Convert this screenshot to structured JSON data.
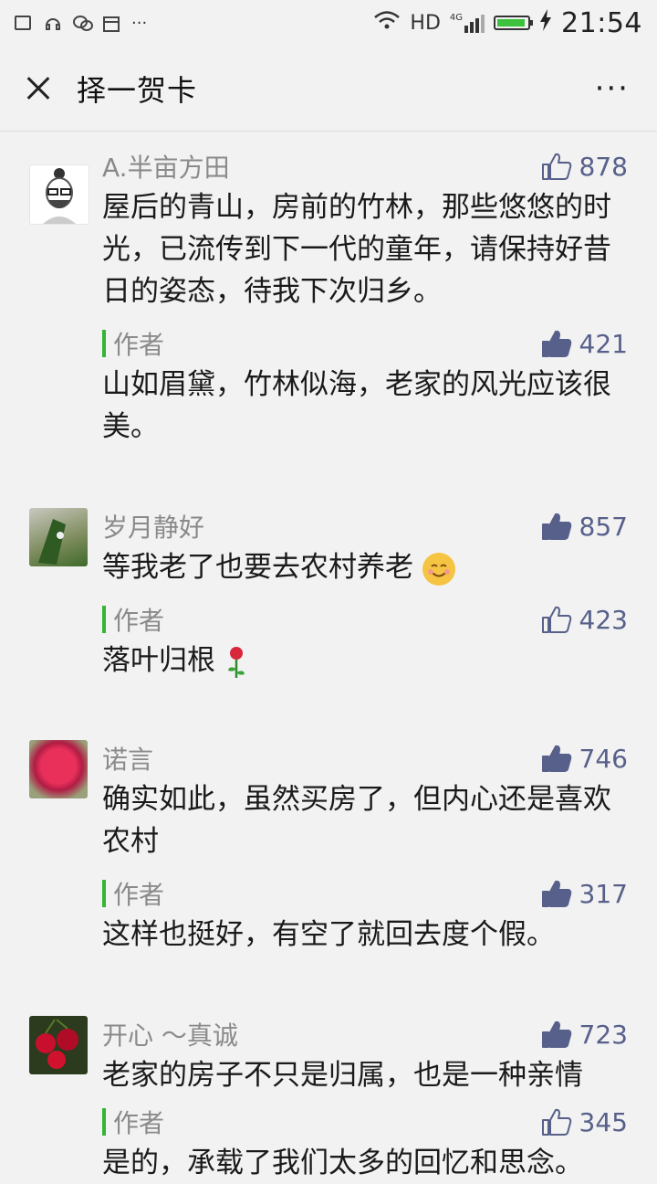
{
  "status_bar": {
    "hd_label": "HD",
    "network": "4G",
    "time": "21:54",
    "dots": "···",
    "battery_level": 0.95
  },
  "nav": {
    "title": "择一贺卡",
    "more": "···"
  },
  "comments": [
    {
      "nickname": "A.半亩方田",
      "likes": "878",
      "liked": false,
      "text": "屋后的青山，房前的竹林，那些悠悠的时光，已流传到下一代的童年，请保持好昔日的姿态，待我下次归乡。",
      "reply": {
        "tag": "作者",
        "likes": "421",
        "liked": true,
        "text": "山如眉黛，竹林似海，老家的风光应该很美。"
      }
    },
    {
      "nickname": "岁月静好",
      "likes": "857",
      "liked": true,
      "text": "等我老了也要去农村养老",
      "emoji": "smiling-face-emoji",
      "reply": {
        "tag": "作者",
        "likes": "423",
        "liked": false,
        "text": "落叶归根",
        "emoji": "rose-emoji"
      }
    },
    {
      "nickname": "诺言",
      "likes": "746",
      "liked": true,
      "text": "确实如此，虽然买房了，但内心还是喜欢农村",
      "reply": {
        "tag": "作者",
        "likes": "317",
        "liked": true,
        "text": "这样也挺好，有空了就回去度个假。"
      }
    },
    {
      "nickname": "开心 〜真诚",
      "likes": "723",
      "liked": true,
      "text": "老家的房子不只是归属，也是一种亲情",
      "reply": {
        "tag": "作者",
        "likes": "345",
        "liked": false,
        "text": "是的，承载了我们太多的回忆和思念。"
      }
    }
  ]
}
